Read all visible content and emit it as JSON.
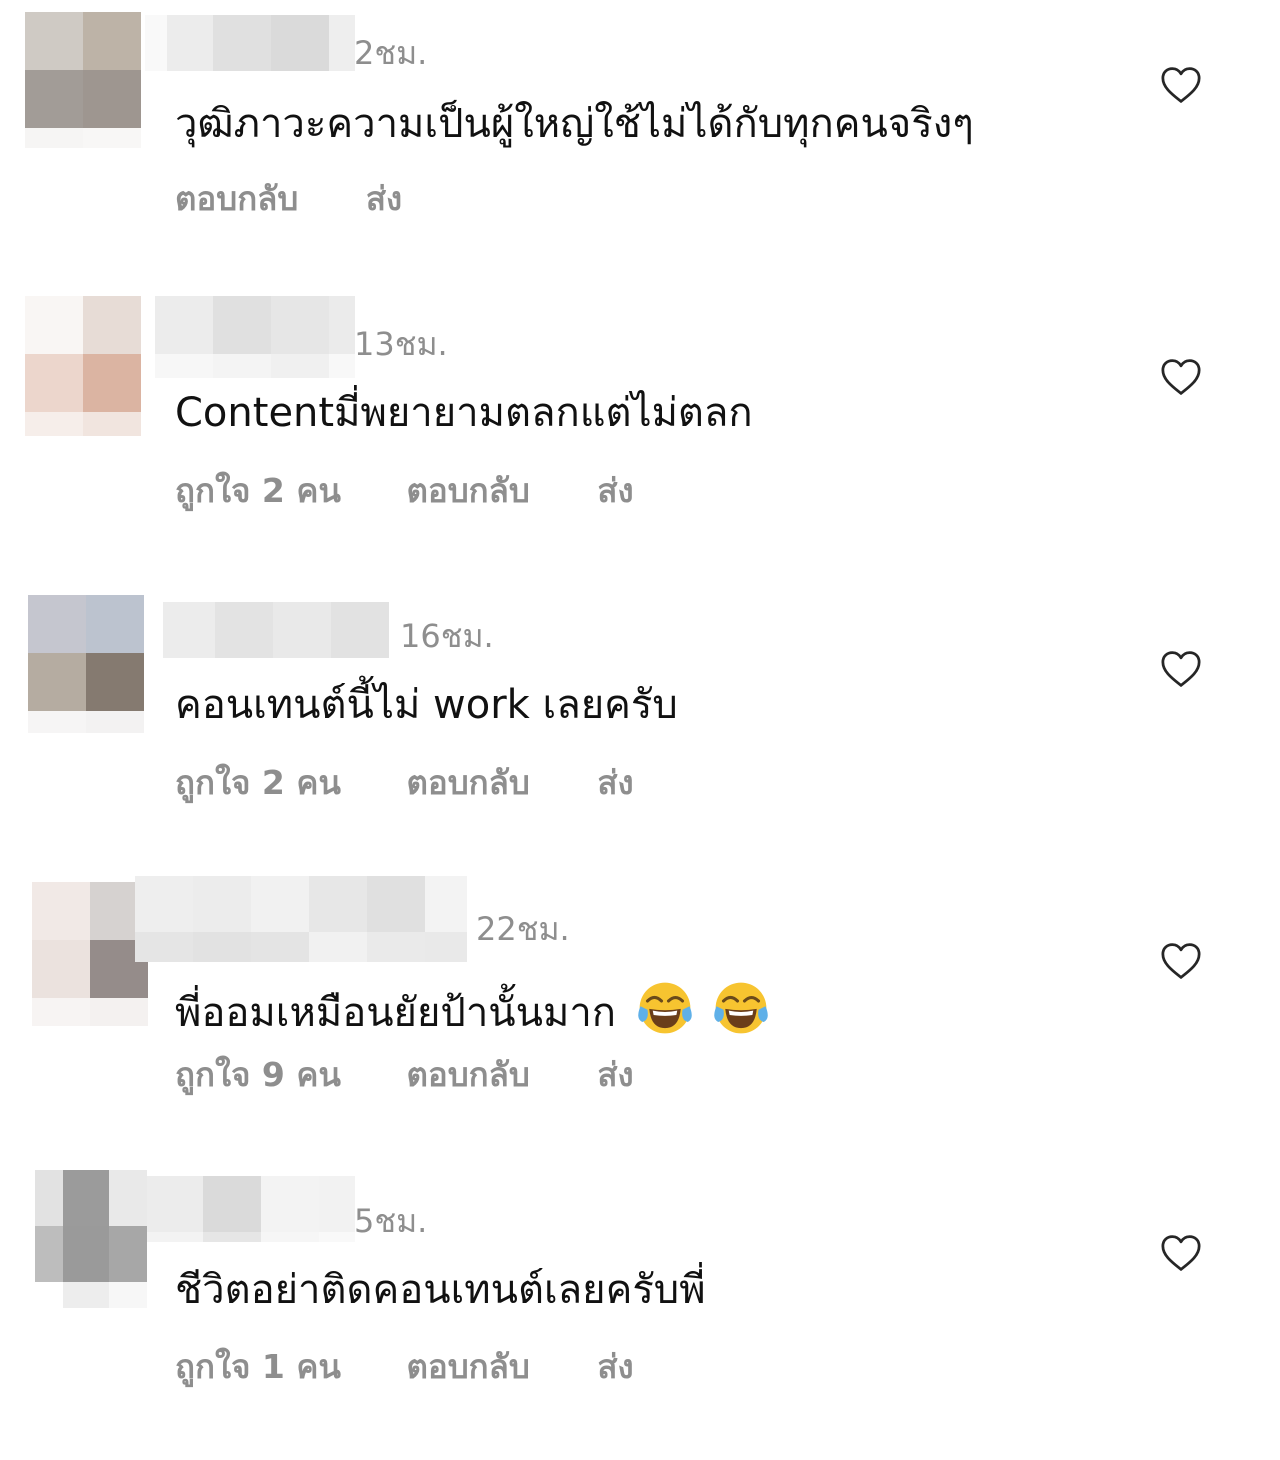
{
  "comments": [
    {
      "time": "2ชม.",
      "text": "วุฒิภาวะความเป็นผู้ใหญ่ใช้ไม่ได้กับทุกคนจริงๆ",
      "likes": "",
      "reply": "ตอบกลับ",
      "send": "ส่ง"
    },
    {
      "time": "13ชม.",
      "text": "Contentมี่พยายามตลกแต่ไม่ตลก",
      "likes": "ถูกใจ 2 คน",
      "reply": "ตอบกลับ",
      "send": "ส่ง"
    },
    {
      "time": "16ชม.",
      "text": "คอนเทนต์นี้ไม่ work เลยครับ",
      "likes": "ถูกใจ 2 คน",
      "reply": "ตอบกลับ",
      "send": "ส่ง"
    },
    {
      "time": "22ชม.",
      "text": "พี่ออมเหมือนยัยป้านั้นมาก",
      "emoji": [
        "face-with-tears-of-joy",
        "face-with-tears-of-joy"
      ],
      "likes": "ถูกใจ 9 คน",
      "reply": "ตอบกลับ",
      "send": "ส่ง"
    },
    {
      "time": "5ชม.",
      "text": "ชีวิตอย่าติดคอนเทนต์เลยครับพี่",
      "likes": "ถูกใจ 1 คน",
      "reply": "ตอบกลับ",
      "send": "ส่ง"
    }
  ],
  "colors": {
    "text": "#111111",
    "muted": "#8e8e8e",
    "heart_stroke": "#262626",
    "background": "#ffffff"
  },
  "icons": {
    "like": "heart-outline-icon",
    "emoji": "face-with-tears-of-joy"
  }
}
